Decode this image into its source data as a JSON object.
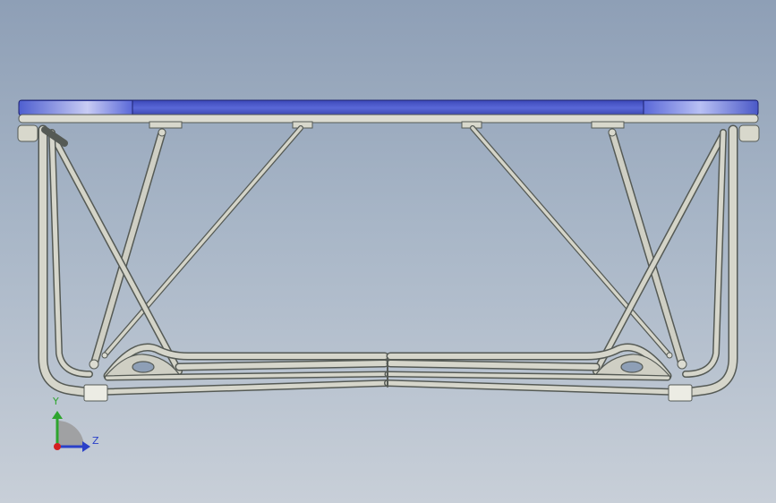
{
  "viewport": {
    "background_top": "#8e9fb6",
    "background_bottom": "#c8cfd8"
  },
  "model": {
    "top_plate_color": "#4756c8",
    "frame_color": "#d4d4c8",
    "frame_outline_color": "#555a55"
  },
  "triad": {
    "y_label": "Y",
    "z_label": "Z",
    "y_color": "#2ea52e",
    "z_color": "#2a40c8",
    "x_color": "#d42020"
  }
}
